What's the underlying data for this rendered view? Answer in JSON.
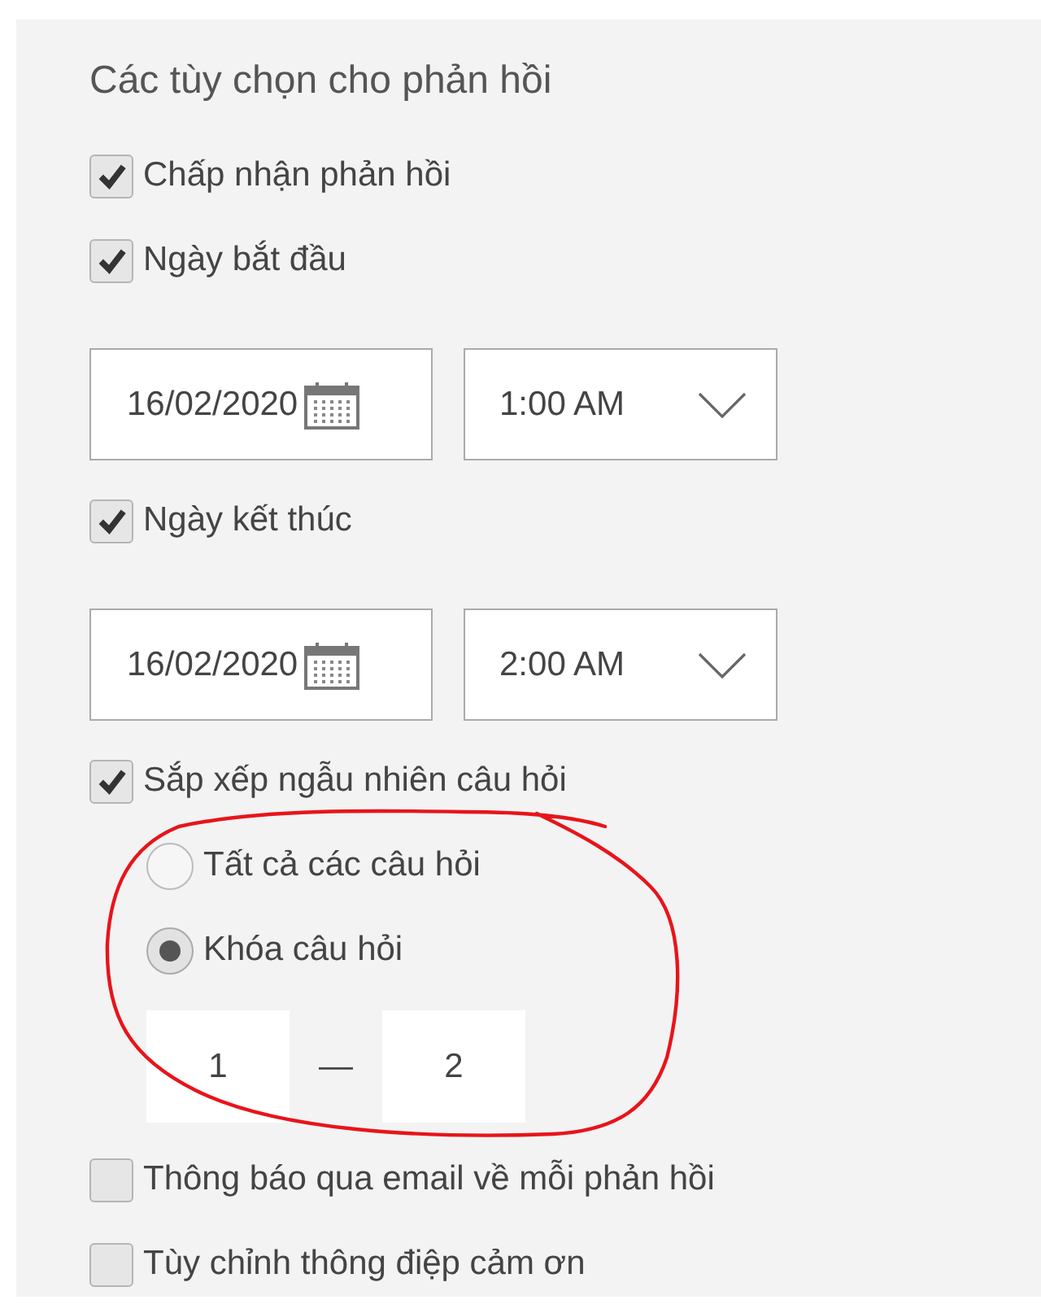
{
  "title": "Các tùy chọn cho phản hồi",
  "items": [
    {
      "kind": "checkbox",
      "label": "Chấp nhận phản hồi",
      "checked": true
    },
    {
      "kind": "checkbox",
      "label": "Ngày bắt đầu",
      "checked": true
    },
    {
      "kind": "datetime",
      "date": "16/02/2020",
      "time": "1:00 AM"
    },
    {
      "kind": "checkbox",
      "label": "Ngày kết thúc",
      "checked": true
    },
    {
      "kind": "datetime",
      "date": "16/02/2020",
      "time": "2:00 AM"
    },
    {
      "kind": "checkbox",
      "label": "Sắp xếp ngẫu nhiên câu hỏi",
      "checked": true,
      "children": [
        {
          "kind": "radio",
          "label": "Tất cả các câu hỏi",
          "selected": false
        },
        {
          "kind": "radio",
          "label": "Khóa câu hỏi",
          "selected": true
        },
        {
          "kind": "range",
          "from": "1",
          "separator": "—",
          "to": "2"
        }
      ]
    },
    {
      "kind": "checkbox",
      "label": "Thông báo qua email về mỗi phản hồi",
      "checked": false
    },
    {
      "kind": "checkbox",
      "label": "Tùy chỉnh thông điệp cảm ơn",
      "checked": false
    }
  ]
}
